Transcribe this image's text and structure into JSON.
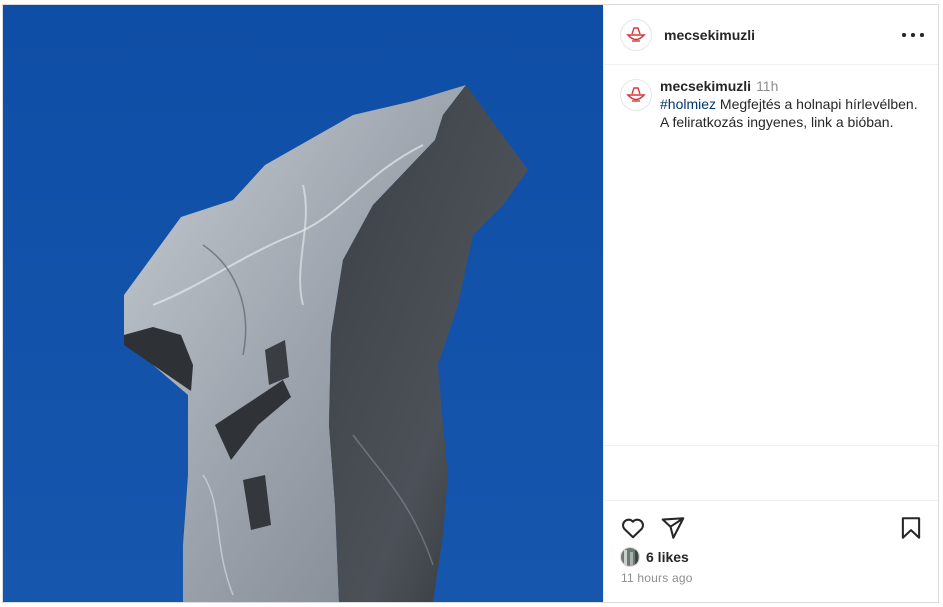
{
  "post": {
    "username": "mecsekimuzli",
    "caption_time": "11h",
    "hashtag": "#holmiez",
    "caption_text": " Megfejtés a holnapi hírlevélben. A feliratkozás ingyenes, link a bióban.",
    "likes": "6 likes",
    "timestamp": "11 hours ago"
  },
  "icons": {
    "avatar": "bowl-logo-icon",
    "more": "more-options-icon",
    "like": "heart-icon",
    "share": "paper-plane-icon",
    "save": "bookmark-icon"
  },
  "colors": {
    "sky": "#1352a6",
    "hashtag": "#00376b",
    "logo": "#d8373c",
    "muted": "#8e8e8e"
  }
}
